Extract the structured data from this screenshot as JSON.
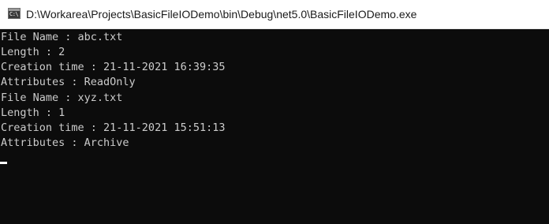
{
  "window": {
    "title": "D:\\Workarea\\Projects\\BasicFileIODemo\\bin\\Debug\\net5.0\\BasicFileIODemo.exe",
    "icon": "console-app-icon",
    "icon_glyph": "C:\\"
  },
  "console": {
    "lines": [
      "File Name : abc.txt",
      "Length : 2",
      "Creation time : 21-11-2021 16:39:35",
      "Attributes : ReadOnly",
      "File Name : xyz.txt",
      "Length : 1",
      "Creation time : 21-11-2021 15:51:13",
      "Attributes : Archive"
    ]
  },
  "colors": {
    "console_background": "#0c0c0c",
    "console_text": "#cccccc",
    "titlebar_background": "#ffffff",
    "cursor": "#ffffff"
  }
}
